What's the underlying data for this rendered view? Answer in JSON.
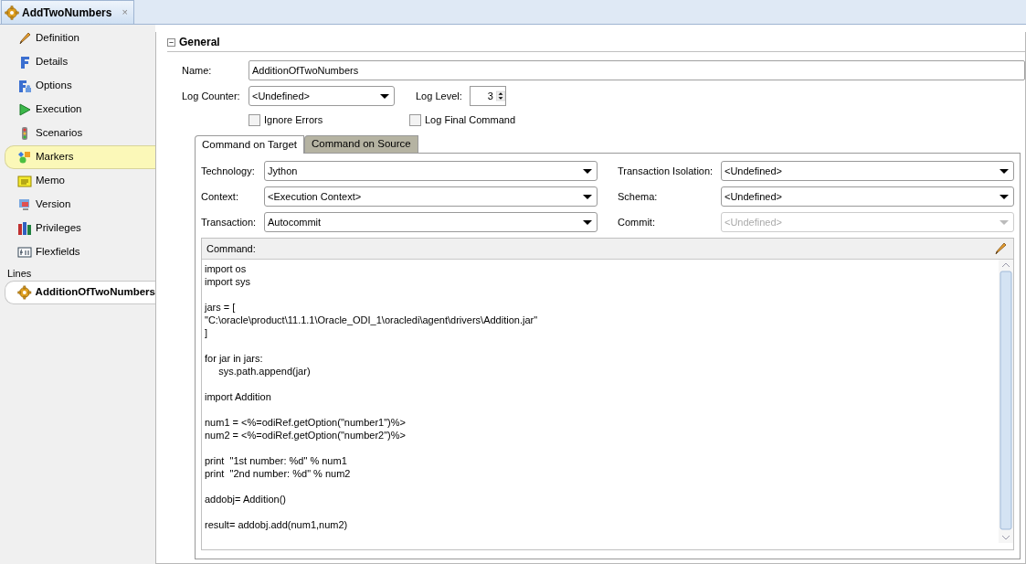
{
  "document_tab": {
    "title": "AddTwoNumbers",
    "close": "×"
  },
  "sidebar": {
    "items": [
      {
        "label": "Definition",
        "selected": false
      },
      {
        "label": "Details",
        "selected": false
      },
      {
        "label": "Options",
        "selected": false
      },
      {
        "label": "Execution",
        "selected": false
      },
      {
        "label": "Scenarios",
        "selected": false
      },
      {
        "label": "Markers",
        "selected": true
      },
      {
        "label": "Memo",
        "selected": false
      },
      {
        "label": "Version",
        "selected": false
      },
      {
        "label": "Privileges",
        "selected": false
      },
      {
        "label": "Flexfields",
        "selected": false
      }
    ],
    "lines_heading": "Lines",
    "lines": [
      {
        "label": "AdditionOfTwoNumbers",
        "selected": true
      }
    ]
  },
  "general": {
    "title": "General",
    "expanded": true,
    "name": {
      "label": "Name:",
      "value": "AdditionOfTwoNumbers"
    },
    "log_counter": {
      "label": "Log Counter:",
      "value": "<Undefined>"
    },
    "log_level": {
      "label": "Log Level:",
      "value": "3"
    },
    "checkboxes": [
      {
        "label": "Ignore Errors",
        "checked": false
      },
      {
        "label": "Log Final Command",
        "checked": false
      }
    ]
  },
  "command_tabs": [
    {
      "label": "Command on Target",
      "selected": true
    },
    {
      "label": "Command on Source",
      "selected": false
    }
  ],
  "fields": [
    {
      "label": "Technology:",
      "value": "Jython",
      "disabled": false
    },
    {
      "label": "Transaction Isolation:",
      "value": "<Undefined>",
      "disabled": false
    },
    {
      "label": "Context:",
      "value": "<Execution Context>",
      "disabled": false
    },
    {
      "label": "Schema:",
      "value": "<Undefined>",
      "disabled": false
    },
    {
      "label": "Transaction:",
      "value": "Autocommit",
      "disabled": false
    },
    {
      "label": "Commit:",
      "value": "<Undefined>",
      "disabled": true
    }
  ],
  "command": {
    "label": "Command:",
    "code": "import os\nimport sys\n\njars = [\n\"C:\\oracle\\product\\11.1.1\\Oracle_ODI_1\\oracledi\\agent\\drivers\\Addition.jar\"\n]\n\nfor jar in jars:\n     sys.path.append(jar)\n\nimport Addition\n\nnum1 = <%=odiRef.getOption(\"number1\")%>\nnum2 = <%=odiRef.getOption(\"number2\")%>\n\nprint  \"1st number: %d\" % num1\nprint  \"2nd number: %d\" % num2\n\naddobj= Addition()\n\nresult= addobj.add(num1,num2)"
  }
}
